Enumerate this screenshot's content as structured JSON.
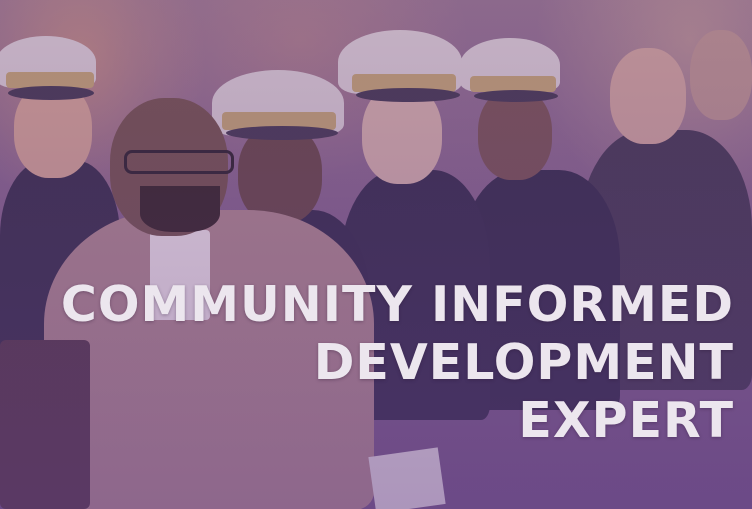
{
  "headline": {
    "lines": [
      "COMMUNITY INFORMED",
      "DEVELOPMENT",
      "EXPERT"
    ]
  },
  "colors": {
    "overlay_tint": "#7d5c82",
    "headline_text": "#ece6ee",
    "uniform": "#2c2440",
    "cap": "#cfc3c9"
  }
}
